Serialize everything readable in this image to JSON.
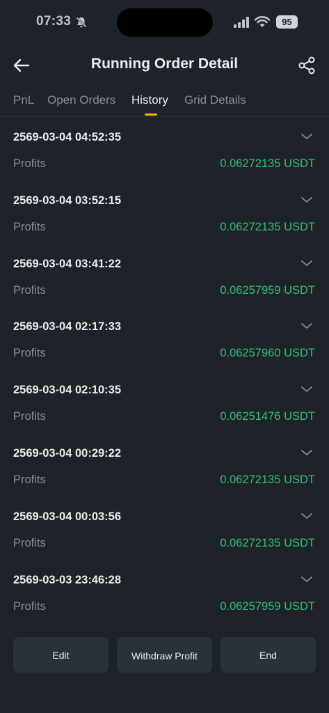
{
  "status_bar": {
    "time": "07:33",
    "battery": "95"
  },
  "header": {
    "title": "Running Order Detail"
  },
  "tabs": [
    {
      "label": "PnL",
      "active": false
    },
    {
      "label": "Open Orders",
      "active": false
    },
    {
      "label": "History",
      "active": true
    },
    {
      "label": "Grid Details",
      "active": false
    }
  ],
  "history": [
    {
      "time": "2569-03-04 04:52:35",
      "label": "Profits",
      "value": "0.06272135 USDT"
    },
    {
      "time": "2569-03-04 03:52:15",
      "label": "Profits",
      "value": "0.06272135 USDT"
    },
    {
      "time": "2569-03-04 03:41:22",
      "label": "Profits",
      "value": "0.06257959 USDT"
    },
    {
      "time": "2569-03-04 02:17:33",
      "label": "Profits",
      "value": "0.06257960 USDT"
    },
    {
      "time": "2569-03-04 02:10:35",
      "label": "Profits",
      "value": "0.06251476 USDT"
    },
    {
      "time": "2569-03-04 00:29:22",
      "label": "Profits",
      "value": "0.06272135 USDT"
    },
    {
      "time": "2569-03-04 00:03:56",
      "label": "Profits",
      "value": "0.06272135 USDT"
    },
    {
      "time": "2569-03-03 23:46:28",
      "label": "Profits",
      "value": "0.06257959 USDT"
    }
  ],
  "actions": {
    "edit": "Edit",
    "withdraw": "Withdraw Profit",
    "end": "End"
  },
  "colors": {
    "background": "#1e2329",
    "profit": "#2ebd85",
    "accent": "#f0b90b",
    "button": "#2b3139"
  },
  "icons": {
    "back": "arrow-left-icon",
    "share": "share-icon",
    "expand": "chevron-down-icon",
    "bell": "bell-slash-icon",
    "signal": "cellular-signal-icon",
    "wifi": "wifi-icon"
  }
}
